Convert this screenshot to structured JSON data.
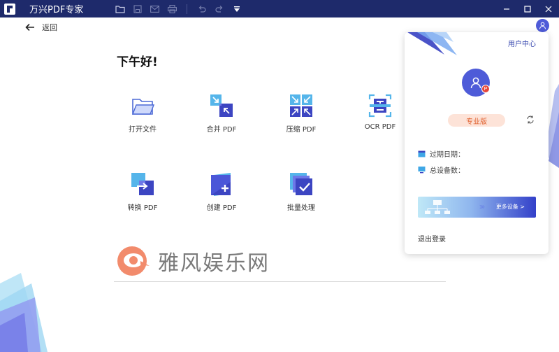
{
  "app": {
    "title": "万兴PDF专家"
  },
  "titlebar_icons": [
    "folder-icon",
    "save-icon",
    "mail-icon",
    "print-icon",
    "undo-icon",
    "redo-icon",
    "dropdown-icon"
  ],
  "window_controls": [
    "minimize-icon",
    "maximize-icon",
    "close-icon"
  ],
  "nav": {
    "back_label": "返回"
  },
  "greeting": "下午好!",
  "tools": [
    {
      "label": "打开文件",
      "icon": "open-file-icon"
    },
    {
      "label": "合并 PDF",
      "icon": "merge-pdf-icon"
    },
    {
      "label": "压缩 PDF",
      "icon": "compress-pdf-icon"
    },
    {
      "label": "OCR PDF",
      "icon": "ocr-pdf-icon"
    },
    {
      "label": "转换 PDF",
      "icon": "convert-pdf-icon"
    },
    {
      "label": "创建 PDF",
      "icon": "create-pdf-icon"
    },
    {
      "label": "批量处理",
      "icon": "batch-process-icon"
    }
  ],
  "watermark": {
    "text": "雅风娱乐网"
  },
  "profile_panel": {
    "user_center": "用户中心",
    "badge": "P",
    "edition": "专业版",
    "expiry_label": "过期日期：",
    "devices_label": "总设备数：",
    "more_devices": "更多设备 >",
    "logout": "退出登录"
  },
  "colors": {
    "titlebar": "#1e2a6b",
    "accent": "#4e5bd8",
    "pro_tag_bg": "#fde3d8",
    "pro_tag_text": "#e0602e"
  }
}
